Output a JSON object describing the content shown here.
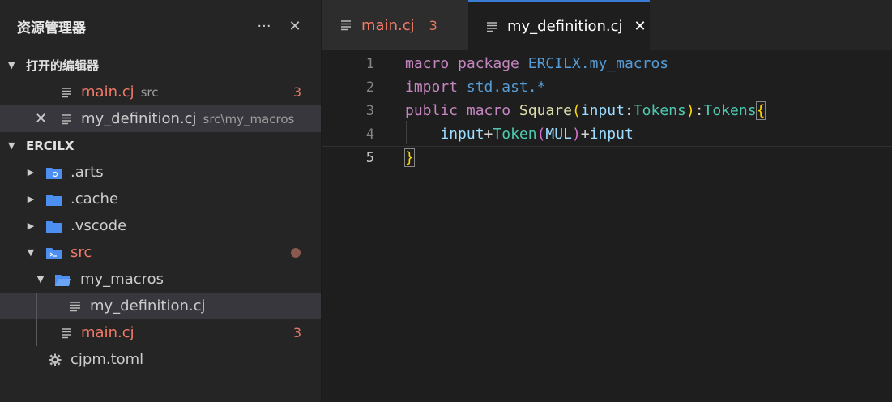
{
  "explorer": {
    "title": "资源管理器",
    "more_label": "···",
    "close_label": "✕"
  },
  "open_editors": {
    "section_title": "打开的编辑器",
    "items": [
      {
        "name": "main.cj",
        "desc": "src",
        "badge": "3"
      },
      {
        "close": "✕",
        "name": "my_definition.cj",
        "desc": "src\\my_macros"
      }
    ]
  },
  "workspace": {
    "section_title": "ERCILX",
    "tree": [
      {
        "name": ".arts"
      },
      {
        "name": ".cache"
      },
      {
        "name": ".vscode"
      },
      {
        "name": "src"
      },
      {
        "name": "my_macros"
      },
      {
        "name": "my_definition.cj"
      },
      {
        "name": "main.cj",
        "badge": "3"
      },
      {
        "name": "cjpm.toml"
      }
    ]
  },
  "tabs": [
    {
      "name": "main.cj",
      "badge": "3"
    },
    {
      "name": "my_definition.cj",
      "close": "✕"
    }
  ],
  "code": {
    "line_numbers": [
      "1",
      "2",
      "3",
      "4",
      "5"
    ],
    "lines": [
      [
        "macro",
        " ",
        "package",
        " ",
        "ERCILX",
        ".",
        "my_macros"
      ],
      [
        "import",
        " ",
        "std",
        ".",
        "ast",
        ".",
        "*"
      ],
      [
        "public",
        " ",
        "macro",
        " ",
        "Square",
        "(",
        "input",
        ":",
        "Tokens",
        ")",
        ":",
        "Tokens",
        "{"
      ],
      [
        "    ",
        "input",
        "+",
        "Token",
        "(",
        "MUL",
        ")",
        "+",
        "input"
      ],
      [
        "}"
      ]
    ]
  },
  "colors": {
    "accent": "#3a7bd5",
    "error": "#f07a66",
    "folder": "#4d8ff0"
  },
  "icons": {
    "file": "lines-icon",
    "folder": "folder-icon",
    "settings": "gear-icon"
  }
}
